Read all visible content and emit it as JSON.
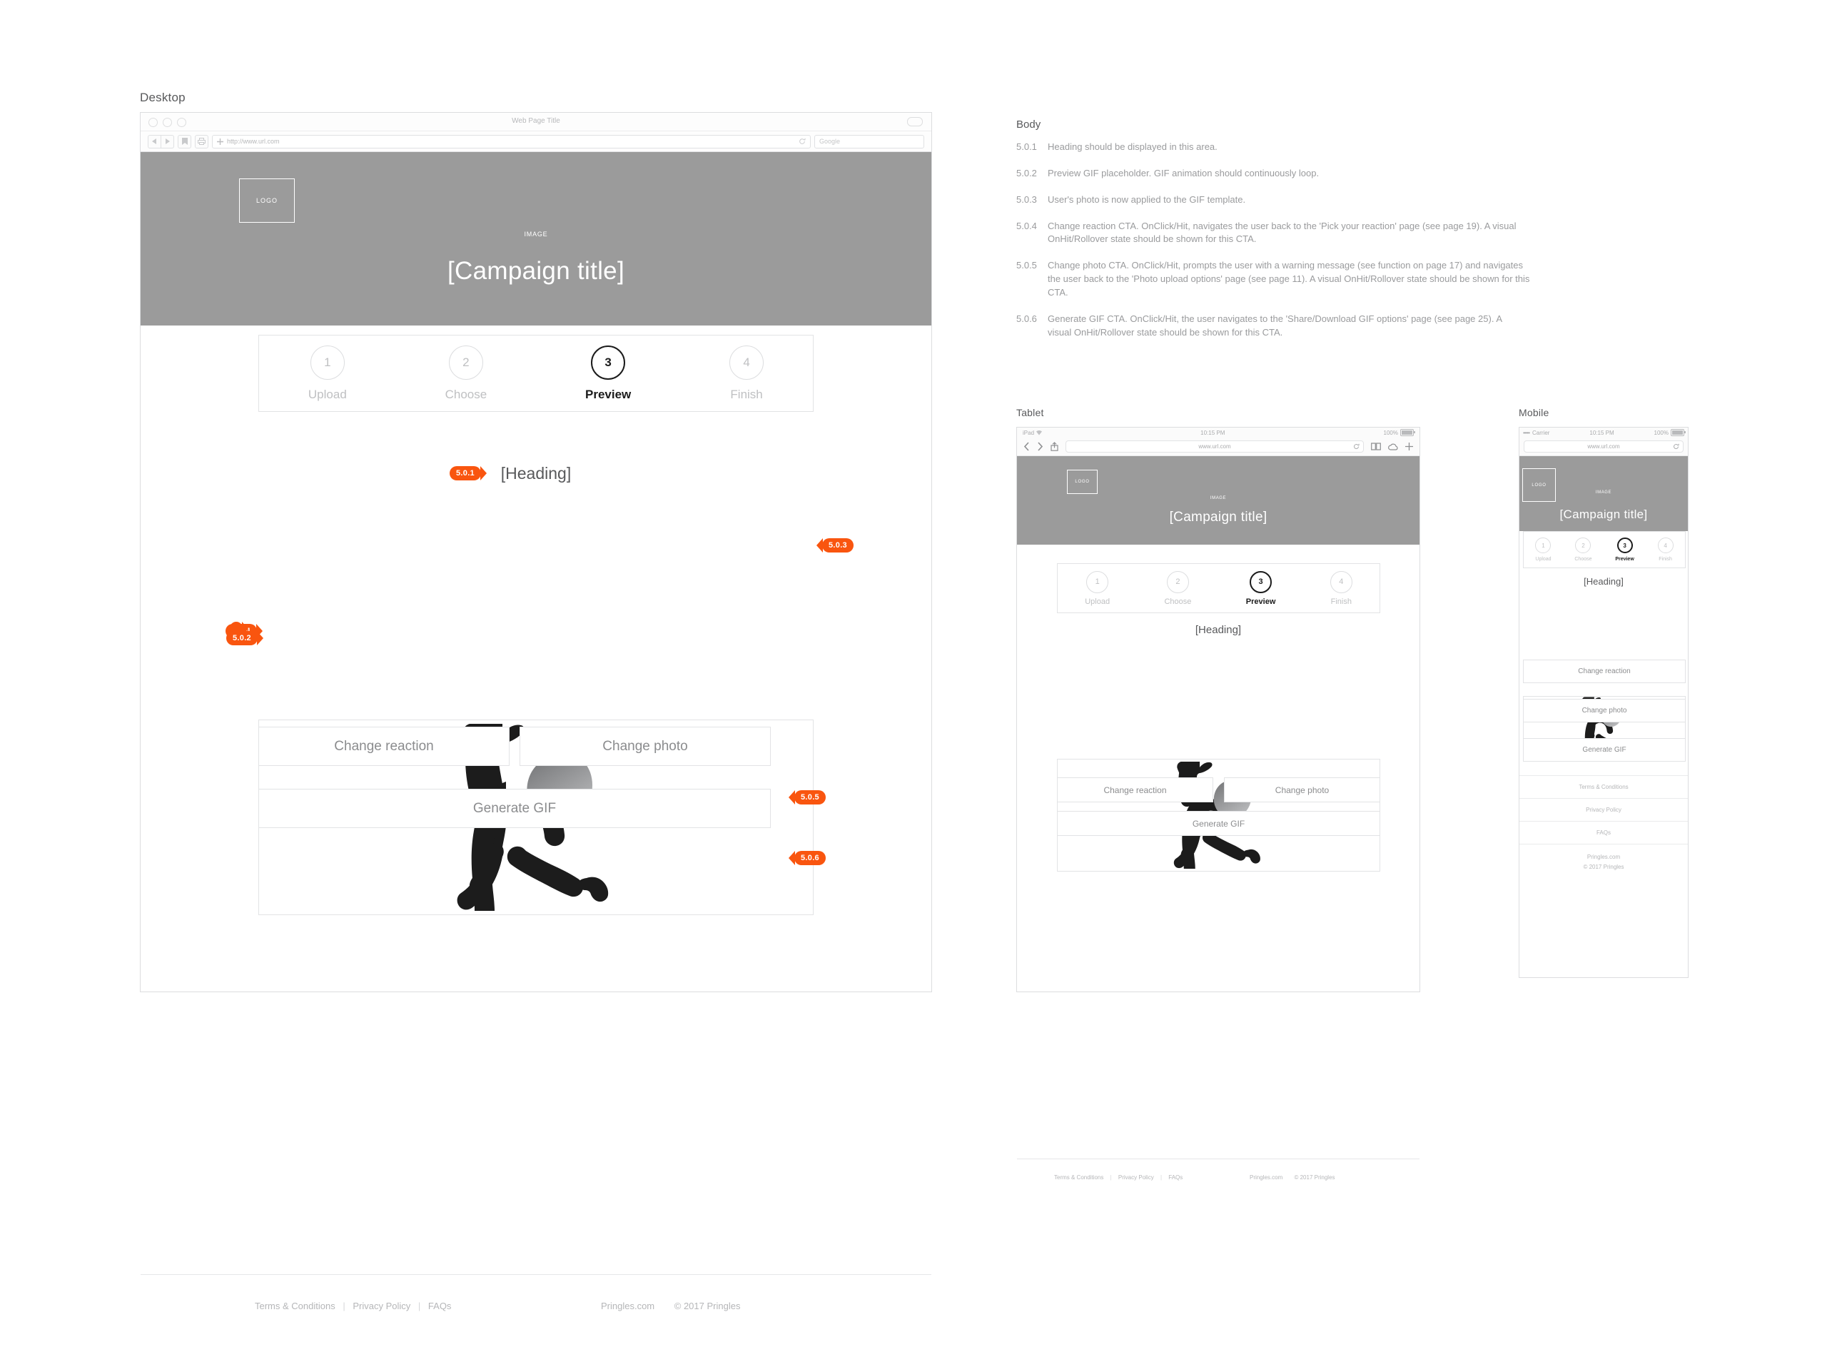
{
  "frames": {
    "desktop_label": "Desktop",
    "tablet_label": "Tablet",
    "mobile_label": "Mobile"
  },
  "desktop_chrome": {
    "web_page_title": "Web Page Title",
    "url": "http://www.url.com",
    "search_placeholder": "Google",
    "back_icon": "back-arrow-icon",
    "forward_icon": "forward-arrow-icon",
    "bookmark_icon": "bookmark-icon",
    "print_icon": "printer-icon",
    "add_icon": "plus-icon",
    "reload_icon": "reload-icon"
  },
  "ios_chrome": {
    "tablet_carrier": "iPad",
    "mobile_carrier": "Carrier",
    "mobile_signal": "•••••",
    "time": "10:15 PM",
    "battery": "100%",
    "url": "www.url.com",
    "back_icon": "chevron-left-icon",
    "forward_icon": "chevron-right-icon",
    "share_icon": "share-icon",
    "reload_icon": "reload-icon",
    "bookmarks_icon": "book-icon",
    "cloud_icon": "cloud-icon",
    "tabs_icon": "plus-icon"
  },
  "hero": {
    "logo": "LOGO",
    "image_label": "IMAGE",
    "campaign_title": "[Campaign title]",
    "bg_color": "#9b9b9b"
  },
  "stepper": {
    "steps": [
      {
        "num": "1",
        "label": "Upload",
        "active": false
      },
      {
        "num": "2",
        "label": "Choose",
        "active": false
      },
      {
        "num": "3",
        "label": "Preview",
        "active": true
      },
      {
        "num": "4",
        "label": "Finish",
        "active": false
      }
    ]
  },
  "content": {
    "heading": "[Heading]",
    "gif_alt": "gif-preview-silhouette"
  },
  "buttons": {
    "change_reaction": "Change reaction",
    "change_photo": "Change photo",
    "generate_gif": "Generate GIF"
  },
  "footer": {
    "terms": "Terms & Conditions",
    "privacy": "Privacy Policy",
    "faqs": "FAQs",
    "site": "Pringles.com",
    "copyright": "© 2017 Pringles",
    "divider": "|"
  },
  "callouts": {
    "c1": "5.0.1",
    "c2": "5.0.2",
    "c3": "5.0.3",
    "c4": "5.0.4",
    "c5": "5.0.5",
    "c6": "5.0.6",
    "color": "#f9550f"
  },
  "notes": {
    "title": "Body",
    "items": [
      {
        "num": "5.0.1",
        "text": "Heading should be displayed in this area."
      },
      {
        "num": "5.0.2",
        "text": "Preview GIF placeholder. GIF animation should continuously loop."
      },
      {
        "num": "5.0.3",
        "text": "User's photo is now applied to the GIF template."
      },
      {
        "num": "5.0.4",
        "text": "Change reaction CTA. OnClick/Hit, navigates the user back to the 'Pick your reaction' page (see page 19). A visual OnHit/Rollover state should be shown for this CTA."
      },
      {
        "num": "5.0.5",
        "text": "Change photo CTA. OnClick/Hit, prompts the user with a warning message (see function on page 17) and navigates the user back to the 'Photo upload options' page (see page 11). A visual OnHit/Rollover state should be shown for this CTA."
      },
      {
        "num": "5.0.6",
        "text": "Generate GIF CTA. OnClick/Hit, the user navigates to the 'Share/Download GIF options' page (see page 25). A visual OnHit/Rollover state should be shown for this CTA."
      }
    ]
  }
}
